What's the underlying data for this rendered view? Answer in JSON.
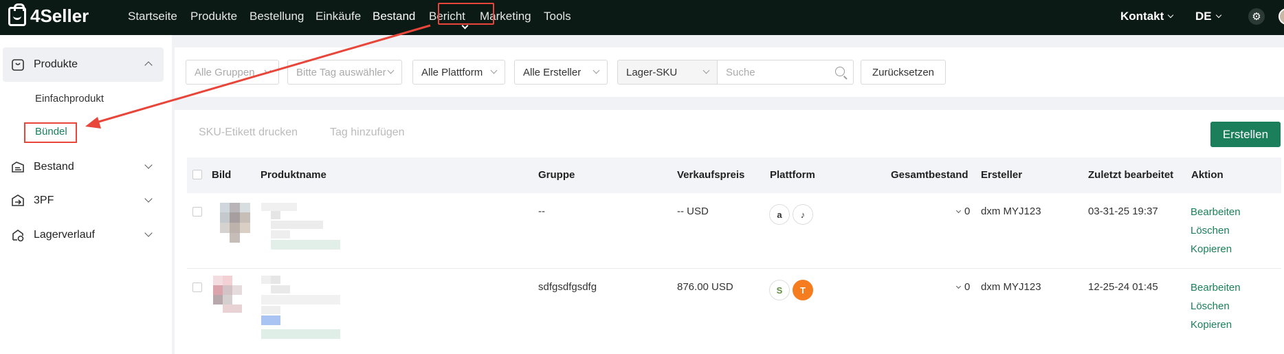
{
  "nav": {
    "brand": "4Seller",
    "items": [
      "Startseite",
      "Produkte",
      "Bestellung",
      "Einkäufe",
      "Bestand",
      "Bericht",
      "Marketing",
      "Tools"
    ],
    "active": "Bestand",
    "contact": "Kontakt",
    "language": "DE"
  },
  "sidebar": {
    "sections": [
      {
        "label": "Produkte",
        "expanded": true,
        "icon": "product-icon"
      },
      {
        "label": "Bestand",
        "expanded": false,
        "icon": "inventory-icon"
      },
      {
        "label": "3PF",
        "expanded": false,
        "icon": "warehouse-icon"
      },
      {
        "label": "Lagerverlauf",
        "expanded": false,
        "icon": "history-icon"
      }
    ],
    "subitems": [
      "Einfachprodukt",
      "Bündel"
    ],
    "active_sub": "Bündel"
  },
  "filters": {
    "groups_placeholder": "Alle Gruppen",
    "tag_placeholder": "Bitte Tag auswähler",
    "platform": "Alle Plattform",
    "creator": "Alle Ersteller",
    "search_field": "Lager-SKU",
    "search_placeholder": "Suche",
    "reset": "Zurücksetzen"
  },
  "toolbar": {
    "print_label": "SKU-Etikett drucken",
    "add_tag": "Tag hinzufügen",
    "create": "Erstellen"
  },
  "table": {
    "columns": [
      "Bild",
      "Produktname",
      "Gruppe",
      "Verkaufspreis",
      "Plattform",
      "Gesamtbestand",
      "Ersteller",
      "Zuletzt bearbeitet",
      "Aktion"
    ],
    "rows": [
      {
        "group": "--",
        "price": "-- USD",
        "platforms": [
          "amazon",
          "tiktok"
        ],
        "stock": "0",
        "creator": "dxm MYJ123",
        "edited": "03-31-25 19:37",
        "actions": [
          "Bearbeiten",
          "Löschen",
          "Kopieren"
        ]
      },
      {
        "group": "sdfgsdfgsdfg",
        "price": "876.00 USD",
        "platforms": [
          "shopify",
          "temu"
        ],
        "stock": "0",
        "creator": "dxm MYJ123",
        "edited": "12-25-24 01:45",
        "actions": [
          "Bearbeiten",
          "Löschen",
          "Kopieren"
        ]
      }
    ]
  },
  "colors": {
    "nav_bg": "#0b1a15",
    "accent": "#1a7f5a",
    "annotation": "#e8463a"
  },
  "icons": {
    "settings": "gear-icon",
    "search": "search-icon",
    "amazon_glyph": "a",
    "tiktok_glyph": "♪",
    "shopify_glyph": "S",
    "temu_glyph": "T"
  }
}
